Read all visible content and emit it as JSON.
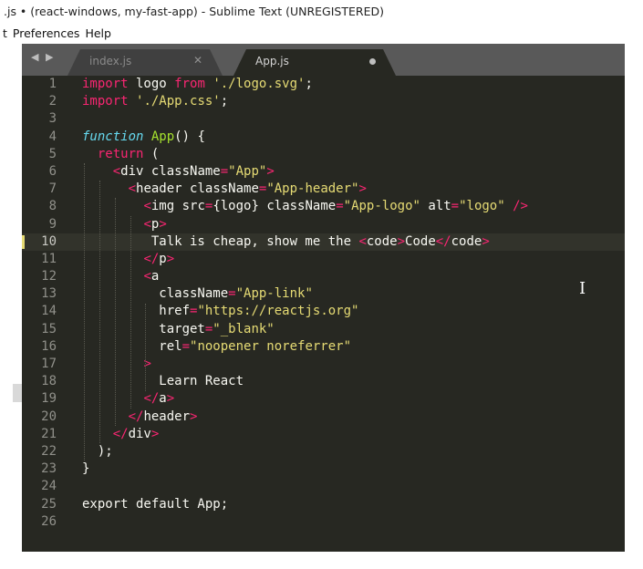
{
  "window": {
    "title": ".js • (react-windows, my-fast-app) - Sublime Text (UNREGISTERED)"
  },
  "menu": {
    "items": [
      "t",
      "Preferences",
      "Help"
    ]
  },
  "tabs": [
    {
      "label": "index.js",
      "state": "inactive",
      "icon": "close-icon"
    },
    {
      "label": "App.js",
      "state": "active",
      "icon": "modified-dot-icon"
    }
  ],
  "colors": {
    "background": "#272822",
    "keyword": "#f92672",
    "function": "#a6e22e",
    "storage": "#66d9ef",
    "string": "#e6db74",
    "text": "#f8f8f2"
  },
  "editor": {
    "current_line": 10,
    "lines": [
      {
        "n": "1",
        "tokens": [
          [
            "kw",
            "import"
          ],
          [
            "pl",
            " logo "
          ],
          [
            "kw",
            "from"
          ],
          [
            "pl",
            " "
          ],
          [
            "st",
            "'./logo.svg'"
          ],
          [
            "pl",
            ";"
          ]
        ]
      },
      {
        "n": "2",
        "tokens": [
          [
            "kw",
            "import"
          ],
          [
            "pl",
            " "
          ],
          [
            "st",
            "'./App.css'"
          ],
          [
            "pl",
            ";"
          ]
        ]
      },
      {
        "n": "3",
        "tokens": []
      },
      {
        "n": "4",
        "tokens": [
          [
            "it",
            "function"
          ],
          [
            "pl",
            " "
          ],
          [
            "fn",
            "App"
          ],
          [
            "pl",
            "() {"
          ]
        ]
      },
      {
        "n": "5",
        "tokens": [
          [
            "pl",
            "  "
          ],
          [
            "kw",
            "return"
          ],
          [
            "pl",
            " ("
          ]
        ]
      },
      {
        "n": "6",
        "tokens": [
          [
            "pl",
            "    "
          ],
          [
            "tg",
            "<"
          ],
          [
            "pl",
            "div "
          ],
          [
            "pl",
            "className"
          ],
          [
            "kw",
            "="
          ],
          [
            "st",
            "\"App\""
          ],
          [
            "tg",
            ">"
          ]
        ]
      },
      {
        "n": "7",
        "tokens": [
          [
            "pl",
            "      "
          ],
          [
            "tg",
            "<"
          ],
          [
            "pl",
            "header "
          ],
          [
            "pl",
            "className"
          ],
          [
            "kw",
            "="
          ],
          [
            "st",
            "\"App-header\""
          ],
          [
            "tg",
            ">"
          ]
        ]
      },
      {
        "n": "8",
        "tokens": [
          [
            "pl",
            "        "
          ],
          [
            "tg",
            "<"
          ],
          [
            "pl",
            "img "
          ],
          [
            "pl",
            "src"
          ],
          [
            "kw",
            "="
          ],
          [
            "pl",
            "{logo} "
          ],
          [
            "pl",
            "className"
          ],
          [
            "kw",
            "="
          ],
          [
            "st",
            "\"App-logo\""
          ],
          [
            "pl",
            " alt"
          ],
          [
            "kw",
            "="
          ],
          [
            "st",
            "\"logo\""
          ],
          [
            "pl",
            " "
          ],
          [
            "tg",
            "/>"
          ]
        ]
      },
      {
        "n": "9",
        "tokens": [
          [
            "pl",
            "        "
          ],
          [
            "tg",
            "<"
          ],
          [
            "pl",
            "p"
          ],
          [
            "tg",
            ">"
          ]
        ]
      },
      {
        "n": "10",
        "tokens": [
          [
            "pl",
            "         Talk is cheap, show me the "
          ],
          [
            "tg",
            "<"
          ],
          [
            "pl",
            "code"
          ],
          [
            "tg",
            ">"
          ],
          [
            "pl",
            "Code"
          ],
          [
            "tg",
            "</"
          ],
          [
            "pl",
            "code"
          ],
          [
            "tg",
            ">"
          ]
        ]
      },
      {
        "n": "11",
        "tokens": [
          [
            "pl",
            "        "
          ],
          [
            "tg",
            "</"
          ],
          [
            "pl",
            "p"
          ],
          [
            "tg",
            ">"
          ]
        ]
      },
      {
        "n": "12",
        "tokens": [
          [
            "pl",
            "        "
          ],
          [
            "tg",
            "<"
          ],
          [
            "pl",
            "a"
          ]
        ]
      },
      {
        "n": "13",
        "tokens": [
          [
            "pl",
            "          className"
          ],
          [
            "kw",
            "="
          ],
          [
            "st",
            "\"App-link\""
          ]
        ]
      },
      {
        "n": "14",
        "tokens": [
          [
            "pl",
            "          href"
          ],
          [
            "kw",
            "="
          ],
          [
            "st",
            "\"https://reactjs.org\""
          ]
        ]
      },
      {
        "n": "15",
        "tokens": [
          [
            "pl",
            "          target"
          ],
          [
            "kw",
            "="
          ],
          [
            "st",
            "\"_blank\""
          ]
        ]
      },
      {
        "n": "16",
        "tokens": [
          [
            "pl",
            "          rel"
          ],
          [
            "kw",
            "="
          ],
          [
            "st",
            "\"noopener noreferrer\""
          ]
        ]
      },
      {
        "n": "17",
        "tokens": [
          [
            "pl",
            "        "
          ],
          [
            "tg",
            ">"
          ]
        ]
      },
      {
        "n": "18",
        "tokens": [
          [
            "pl",
            "          Learn React"
          ]
        ]
      },
      {
        "n": "19",
        "tokens": [
          [
            "pl",
            "        "
          ],
          [
            "tg",
            "</"
          ],
          [
            "pl",
            "a"
          ],
          [
            "tg",
            ">"
          ]
        ]
      },
      {
        "n": "20",
        "tokens": [
          [
            "pl",
            "      "
          ],
          [
            "tg",
            "</"
          ],
          [
            "pl",
            "header"
          ],
          [
            "tg",
            ">"
          ]
        ]
      },
      {
        "n": "21",
        "tokens": [
          [
            "pl",
            "    "
          ],
          [
            "tg",
            "</"
          ],
          [
            "pl",
            "div"
          ],
          [
            "tg",
            ">"
          ]
        ]
      },
      {
        "n": "22",
        "tokens": [
          [
            "pl",
            "  );"
          ]
        ]
      },
      {
        "n": "23",
        "tokens": [
          [
            "pl",
            "}"
          ]
        ]
      },
      {
        "n": "24",
        "tokens": []
      },
      {
        "n": "25",
        "tokens": [
          [
            "pl",
            "export default App;"
          ]
        ]
      },
      {
        "n": "26",
        "tokens": []
      }
    ]
  }
}
